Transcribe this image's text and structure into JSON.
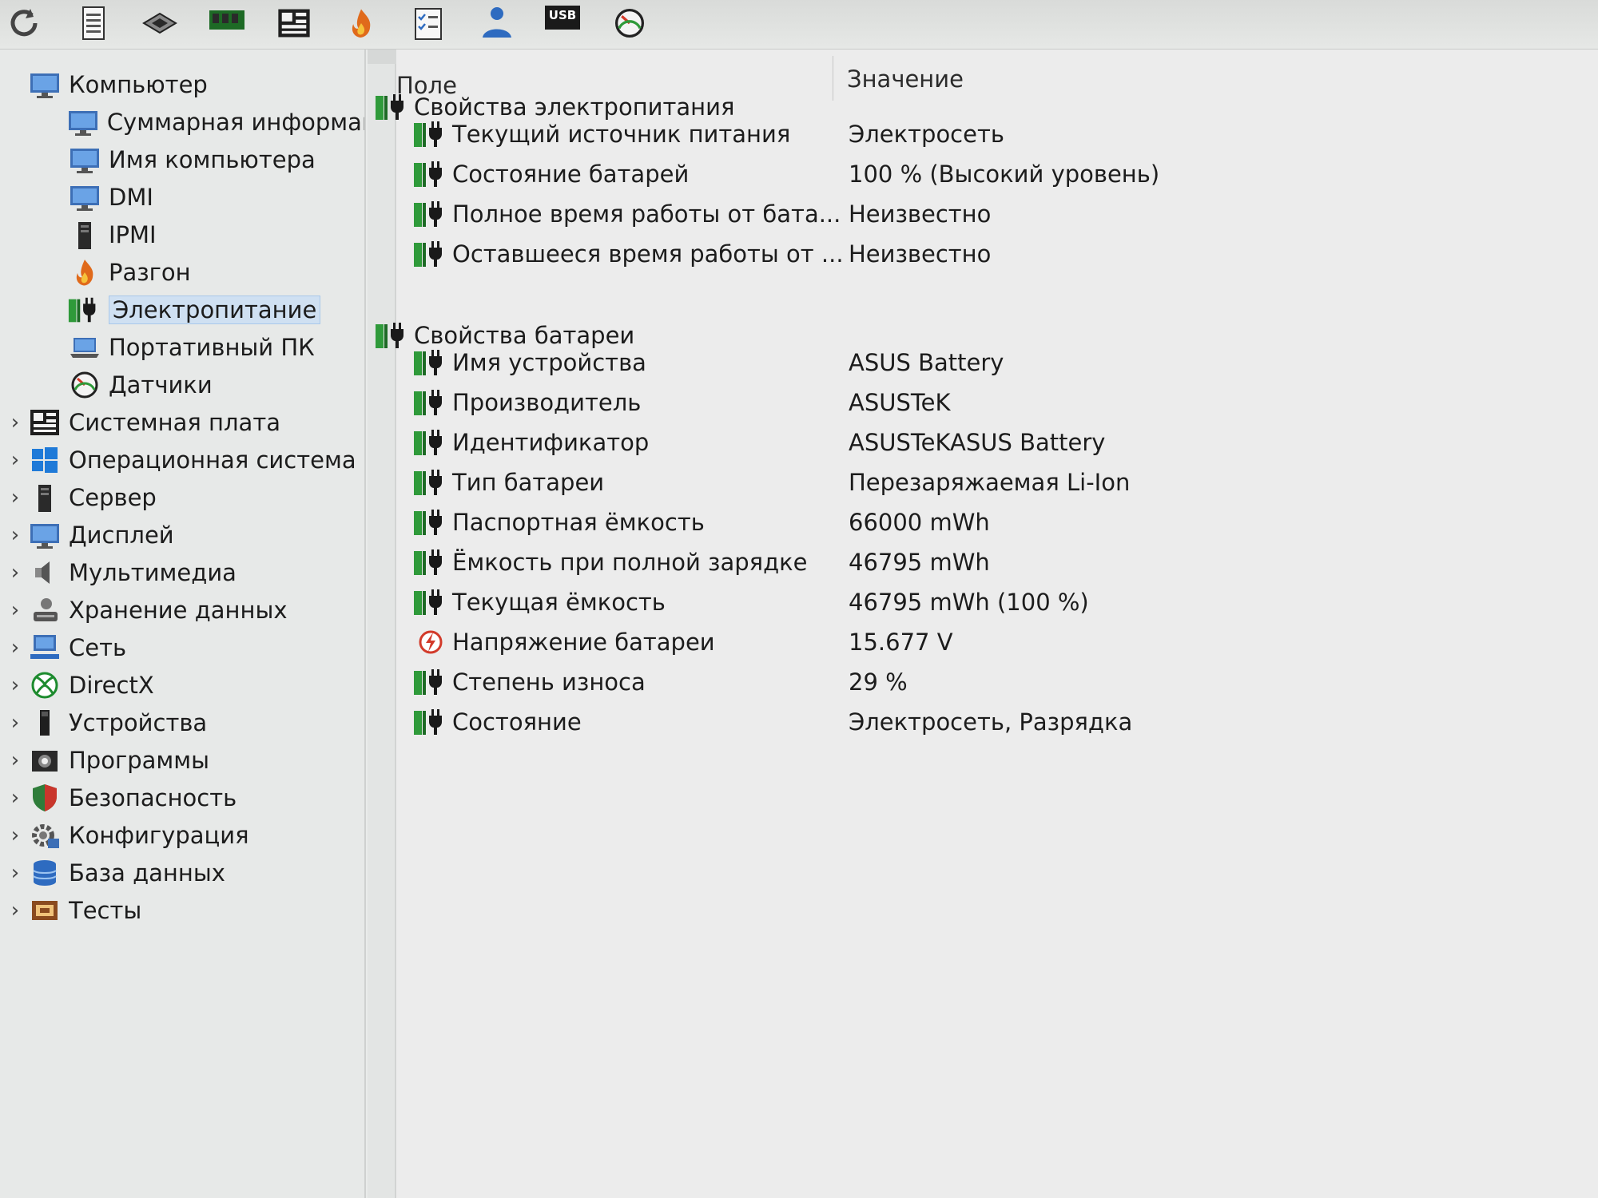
{
  "columns": {
    "field": "Поле",
    "value": "Значение"
  },
  "tree": [
    {
      "label": "Компьютер",
      "level": 0,
      "expander": "",
      "icon": "monitor-icon"
    },
    {
      "label": "Суммарная информаци",
      "level": 1,
      "expander": "",
      "icon": "monitor-icon"
    },
    {
      "label": "Имя компьютера",
      "level": 1,
      "expander": "",
      "icon": "monitor-icon"
    },
    {
      "label": "DMI",
      "level": 1,
      "expander": "",
      "icon": "monitor-icon"
    },
    {
      "label": "IPMI",
      "level": 1,
      "expander": "",
      "icon": "server-tower-icon"
    },
    {
      "label": "Разгон",
      "level": 1,
      "expander": "",
      "icon": "flame-icon"
    },
    {
      "label": "Электропитание",
      "level": 1,
      "expander": "",
      "icon": "power-plug-icon",
      "selected": true
    },
    {
      "label": "Портативный ПК",
      "level": 1,
      "expander": "",
      "icon": "laptop-icon"
    },
    {
      "label": "Датчики",
      "level": 1,
      "expander": "",
      "icon": "gauge-icon"
    },
    {
      "label": "Системная плата",
      "level": 0,
      "expander": "›",
      "icon": "motherboard-icon"
    },
    {
      "label": "Операционная система",
      "level": 0,
      "expander": "›",
      "icon": "windows-logo-icon"
    },
    {
      "label": "Сервер",
      "level": 0,
      "expander": "›",
      "icon": "server-tower-icon"
    },
    {
      "label": "Дисплей",
      "level": 0,
      "expander": "›",
      "icon": "monitor-icon"
    },
    {
      "label": "Мультимедиа",
      "level": 0,
      "expander": "›",
      "icon": "speaker-icon"
    },
    {
      "label": "Хранение данных",
      "level": 0,
      "expander": "›",
      "icon": "storage-user-icon"
    },
    {
      "label": "Сеть",
      "level": 0,
      "expander": "›",
      "icon": "network-icon"
    },
    {
      "label": "DirectX",
      "level": 0,
      "expander": "›",
      "icon": "xbox-logo-icon"
    },
    {
      "label": "Устройства",
      "level": 0,
      "expander": "›",
      "icon": "device-icon"
    },
    {
      "label": "Программы",
      "level": 0,
      "expander": "›",
      "icon": "programs-icon"
    },
    {
      "label": "Безопасность",
      "level": 0,
      "expander": "›",
      "icon": "shield-icon"
    },
    {
      "label": "Конфигурация",
      "level": 0,
      "expander": "›",
      "icon": "config-gear-icon"
    },
    {
      "label": "База данных",
      "level": 0,
      "expander": "›",
      "icon": "database-icon"
    },
    {
      "label": "Тесты",
      "level": 0,
      "expander": "›",
      "icon": "tests-icon"
    }
  ],
  "groups": [
    {
      "title": "Свойства электропитания",
      "rows": [
        {
          "field": "Текущий источник питания",
          "value": "Электросеть",
          "icon": "power-plug-icon"
        },
        {
          "field": "Состояние батарей",
          "value": "100 % (Высокий уровень)",
          "icon": "power-plug-icon"
        },
        {
          "field": "Полное время работы от бата...",
          "value": "Неизвестно",
          "icon": "power-plug-icon"
        },
        {
          "field": "Оставшееся время работы от ...",
          "value": "Неизвестно",
          "icon": "power-plug-icon"
        }
      ]
    },
    {
      "title": "Свойства батареи",
      "rows": [
        {
          "field": "Имя устройства",
          "value": "ASUS Battery",
          "icon": "power-plug-icon"
        },
        {
          "field": "Производитель",
          "value": "ASUSTeK",
          "icon": "power-plug-icon"
        },
        {
          "field": "Идентификатор",
          "value": "ASUSTeKASUS Battery",
          "icon": "power-plug-icon"
        },
        {
          "field": "Тип батареи",
          "value": "Перезаряжаемая Li-Ion",
          "icon": "power-plug-icon"
        },
        {
          "field": "Паспортная ёмкость",
          "value": "66000 mWh",
          "icon": "power-plug-icon"
        },
        {
          "field": "Ёмкость при полной зарядке",
          "value": "46795 mWh",
          "icon": "power-plug-icon"
        },
        {
          "field": "Текущая ёмкость",
          "value": "46795 mWh  (100 %)",
          "icon": "power-plug-icon"
        },
        {
          "field": "Напряжение батареи",
          "value": "15.677 V",
          "icon": "voltage-icon"
        },
        {
          "field": "Степень износа",
          "value": "29 %",
          "icon": "power-plug-icon"
        },
        {
          "field": "Состояние",
          "value": "Электросеть, Разрядка",
          "icon": "power-plug-icon"
        }
      ]
    }
  ],
  "toolbar": [
    {
      "icon": "refresh-icon"
    },
    {
      "icon": "report-icon"
    },
    {
      "icon": "chip-icon"
    },
    {
      "icon": "memory-icon"
    },
    {
      "icon": "motherboard-icon"
    },
    {
      "icon": "flame-icon"
    },
    {
      "icon": "checklist-icon"
    },
    {
      "icon": "user-icon"
    },
    {
      "icon": "usb-icon"
    },
    {
      "icon": "gauge-icon"
    }
  ],
  "toolbar_usb_text": "USB",
  "colors": {
    "selection": "#cfe0f2",
    "battery_green": "#2f9a3a",
    "background": "#ececec"
  }
}
